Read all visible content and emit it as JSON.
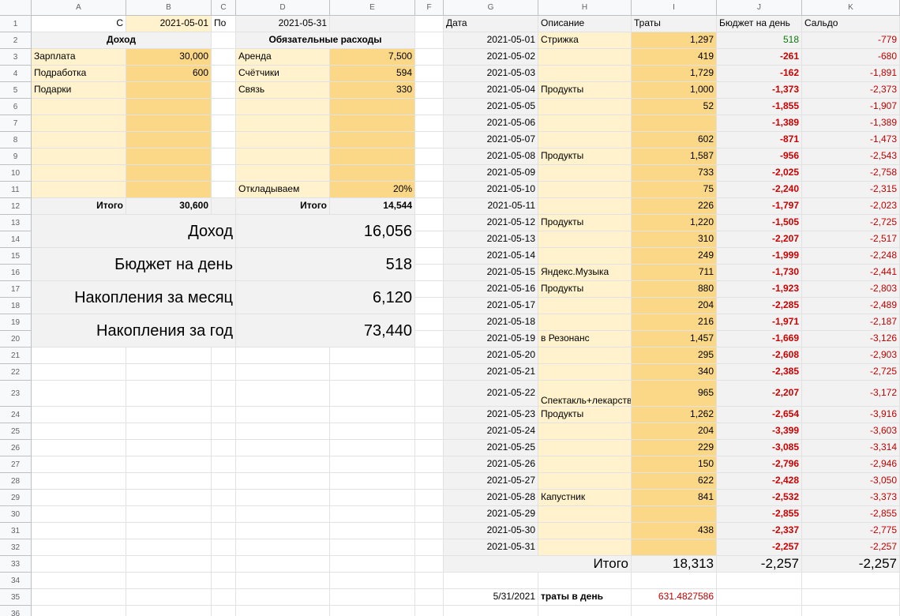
{
  "sheet": {
    "columns": [
      "A",
      "B",
      "C",
      "D",
      "E",
      "F",
      "G",
      "H",
      "I",
      "J",
      "K"
    ],
    "rows": [
      "1",
      "2",
      "3",
      "4",
      "5",
      "6",
      "7",
      "8",
      "9",
      "10",
      "11",
      "12",
      "13",
      "14",
      "15",
      "16",
      "17",
      "18",
      "19",
      "20",
      "21",
      "22",
      "23",
      "24",
      "25",
      "26",
      "27",
      "28",
      "29",
      "30",
      "31",
      "32",
      "33",
      "34",
      "35",
      "36"
    ]
  },
  "period": {
    "from_label": "С",
    "from": "2021-05-01",
    "to_label": "По",
    "to": "2021-05-31"
  },
  "income": {
    "title": "Доход",
    "items": [
      {
        "name": "Зарплата",
        "value": "30,000"
      },
      {
        "name": "Подработка",
        "value": "600"
      },
      {
        "name": "Подарки",
        "value": ""
      }
    ],
    "total_label": "Итого",
    "total": "30,600"
  },
  "expenses": {
    "title": "Обязательные расходы",
    "items": [
      {
        "name": "Аренда",
        "value": "7,500"
      },
      {
        "name": "Счётчики",
        "value": "594"
      },
      {
        "name": "Связь",
        "value": "330"
      }
    ],
    "save_label": "Откладываем",
    "save_value": "20%",
    "total_label": "Итого",
    "total": "14,544"
  },
  "summary": [
    {
      "label": "Доход",
      "value": "16,056"
    },
    {
      "label": "Бюджет на день",
      "value": "518"
    },
    {
      "label": "Накопления за месяц",
      "value": "6,120"
    },
    {
      "label": "Накопления за год",
      "value": "73,440"
    }
  ],
  "log": {
    "headers": {
      "date": "Дата",
      "desc": "Описание",
      "spend": "Траты",
      "budget": "Бюджет на день",
      "balance": "Сальдо"
    },
    "rows": [
      {
        "date": "2021-05-01",
        "desc": "Стрижка",
        "spend": "1,297",
        "budget": "518",
        "balance": "-779",
        "pos": true
      },
      {
        "date": "2021-05-02",
        "desc": "",
        "spend": "419",
        "budget": "-261",
        "balance": "-680"
      },
      {
        "date": "2021-05-03",
        "desc": "",
        "spend": "1,729",
        "budget": "-162",
        "balance": "-1,891"
      },
      {
        "date": "2021-05-04",
        "desc": "Продукты",
        "spend": "1,000",
        "budget": "-1,373",
        "balance": "-2,373"
      },
      {
        "date": "2021-05-05",
        "desc": "",
        "spend": "52",
        "budget": "-1,855",
        "balance": "-1,907"
      },
      {
        "date": "2021-05-06",
        "desc": "",
        "spend": "",
        "budget": "-1,389",
        "balance": "-1,389"
      },
      {
        "date": "2021-05-07",
        "desc": "",
        "spend": "602",
        "budget": "-871",
        "balance": "-1,473"
      },
      {
        "date": "2021-05-08",
        "desc": "Продукты",
        "spend": "1,587",
        "budget": "-956",
        "balance": "-2,543"
      },
      {
        "date": "2021-05-09",
        "desc": "",
        "spend": "733",
        "budget": "-2,025",
        "balance": "-2,758"
      },
      {
        "date": "2021-05-10",
        "desc": "",
        "spend": "75",
        "budget": "-2,240",
        "balance": "-2,315"
      },
      {
        "date": "2021-05-11",
        "desc": "",
        "spend": "226",
        "budget": "-1,797",
        "balance": "-2,023"
      },
      {
        "date": "2021-05-12",
        "desc": "Продукты",
        "spend": "1,220",
        "budget": "-1,505",
        "balance": "-2,725"
      },
      {
        "date": "2021-05-13",
        "desc": "",
        "spend": "310",
        "budget": "-2,207",
        "balance": "-2,517"
      },
      {
        "date": "2021-05-14",
        "desc": "",
        "spend": "249",
        "budget": "-1,999",
        "balance": "-2,248"
      },
      {
        "date": "2021-05-15",
        "desc": "Яндекс.Музыка",
        "spend": "711",
        "budget": "-1,730",
        "balance": "-2,441"
      },
      {
        "date": "2021-05-16",
        "desc": "Продукты",
        "spend": "880",
        "budget": "-1,923",
        "balance": "-2,803"
      },
      {
        "date": "2021-05-17",
        "desc": "",
        "spend": "204",
        "budget": "-2,285",
        "balance": "-2,489"
      },
      {
        "date": "2021-05-18",
        "desc": "",
        "spend": "216",
        "budget": "-1,971",
        "balance": "-2,187"
      },
      {
        "date": "2021-05-19",
        "desc": "в Резонанс",
        "spend": "1,457",
        "budget": "-1,669",
        "balance": "-3,126"
      },
      {
        "date": "2021-05-20",
        "desc": "",
        "spend": "295",
        "budget": "-2,608",
        "balance": "-2,903"
      },
      {
        "date": "2021-05-21",
        "desc": "",
        "spend": "340",
        "budget": "-2,385",
        "balance": "-2,725"
      },
      {
        "date": "2021-05-22",
        "desc": "Спектакль+лекарство",
        "spend": "965",
        "budget": "-2,207",
        "balance": "-3,172"
      },
      {
        "date": "2021-05-23",
        "desc": "Продукты",
        "spend": "1,262",
        "budget": "-2,654",
        "balance": "-3,916"
      },
      {
        "date": "2021-05-24",
        "desc": "",
        "spend": "204",
        "budget": "-3,399",
        "balance": "-3,603"
      },
      {
        "date": "2021-05-25",
        "desc": "",
        "spend": "229",
        "budget": "-3,085",
        "balance": "-3,314"
      },
      {
        "date": "2021-05-26",
        "desc": "",
        "spend": "150",
        "budget": "-2,796",
        "balance": "-2,946"
      },
      {
        "date": "2021-05-27",
        "desc": "",
        "spend": "622",
        "budget": "-2,428",
        "balance": "-3,050"
      },
      {
        "date": "2021-05-28",
        "desc": "Капустник",
        "spend": "841",
        "budget": "-2,532",
        "balance": "-3,373"
      },
      {
        "date": "2021-05-29",
        "desc": "",
        "spend": "",
        "budget": "-2,855",
        "balance": "-2,855"
      },
      {
        "date": "2021-05-30",
        "desc": "",
        "spend": "438",
        "budget": "-2,337",
        "balance": "-2,775"
      },
      {
        "date": "2021-05-31",
        "desc": "",
        "spend": "",
        "budget": "-2,257",
        "balance": "-2,257"
      }
    ],
    "total_label": "Итого",
    "total_spend": "18,313",
    "total_budget": "-2,257",
    "total_balance": "-2,257"
  },
  "footer": {
    "date": "5/31/2021",
    "label": "траты в день",
    "value": "631.4827586"
  }
}
